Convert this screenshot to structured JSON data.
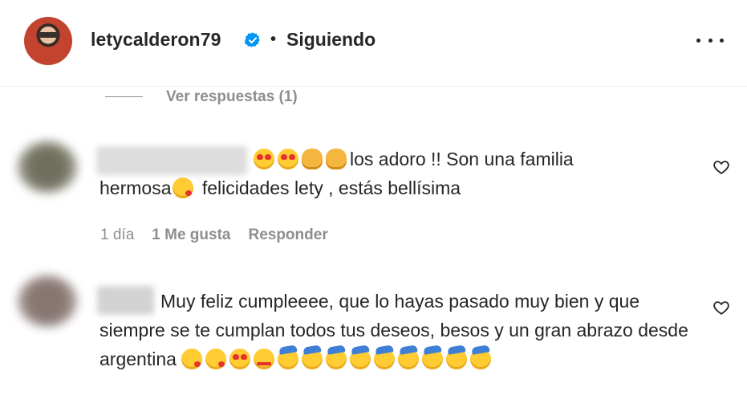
{
  "header": {
    "username": "letycalderon79",
    "separator": "•",
    "follow_status": "Siguiendo",
    "verified": true
  },
  "replies": {
    "label": "Ver respuestas (1)"
  },
  "comments": [
    {
      "emoji_prefix": [
        "smiling-face-with-heart-eyes",
        "smiling-face-with-heart-eyes",
        "clapping-hands",
        "clapping-hands"
      ],
      "text_line1": "los adoro !! Son una familia",
      "text_line2_a": "hermosa",
      "text_line2_emoji": "face-blowing-a-kiss",
      "text_line2_b": " felicidades lety , estás bellísima",
      "time": "1 día",
      "likes": "1 Me gusta",
      "reply_label": "Responder"
    },
    {
      "text": "Muy feliz cumpleeee, que lo hayas pasado muy bien y que siempre se te cumplan todos tus deseos, besos y un gran abrazo desde argentina",
      "emoji_suffix": [
        "face-blowing-a-kiss",
        "face-blowing-a-kiss",
        "smiling-face-with-heart-eyes",
        "smiling-face-with-hearts",
        "partying-face",
        "partying-face",
        "partying-face",
        "partying-face",
        "partying-face",
        "partying-face",
        "partying-face",
        "partying-face",
        "partying-face"
      ]
    }
  ],
  "colors": {
    "text": "#262626",
    "secondary": "#8e8e8e",
    "verified": "#0095f6"
  }
}
